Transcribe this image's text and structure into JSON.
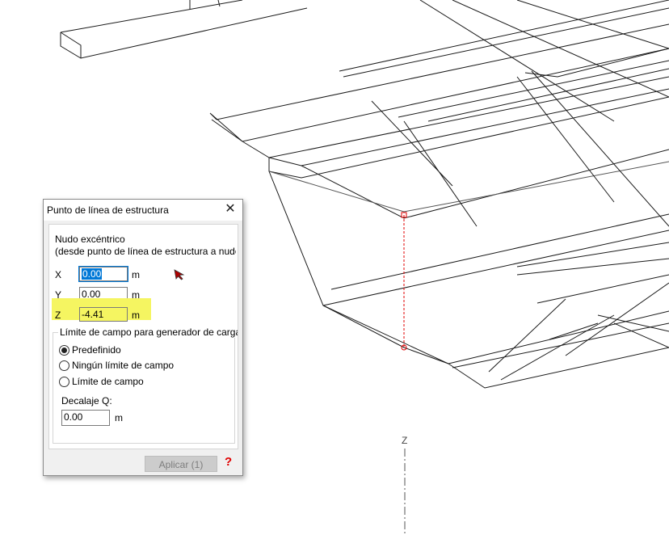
{
  "viewport": {
    "axis_label": "Z"
  },
  "dialog": {
    "title": "Punto de línea de estructura",
    "close_glyph": "✕",
    "section_title": "Nudo excéntrico",
    "section_subtitle": "(desde punto de línea de estructura a nudo",
    "x": {
      "label": "X",
      "value": "0.00",
      "unit": "m"
    },
    "y": {
      "label": "Y",
      "value": "0.00",
      "unit": "m"
    },
    "z": {
      "label": "Z",
      "value": "-4.41",
      "unit": "m"
    },
    "group_title": "Límite de campo para generador de carga",
    "options": [
      "Predefinido",
      "Ningún límite de campo",
      "Límite de campo"
    ],
    "selected_option": "Predefinido",
    "offset_label": "Decalaje Q:",
    "offset_value": "0.00",
    "offset_unit": "m",
    "apply_label": "Aplicar (1)",
    "help_glyph": "?"
  }
}
